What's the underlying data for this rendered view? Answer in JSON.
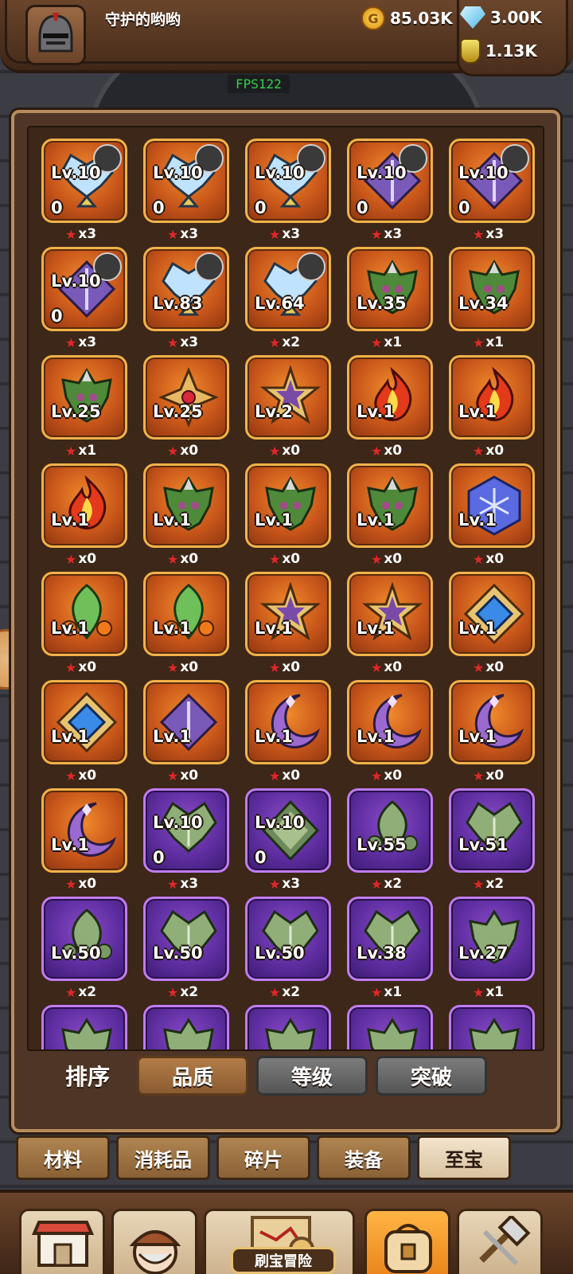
{
  "header": {
    "username": "守护的哟哟",
    "gold": "85.03K",
    "gems": "3.00K",
    "potion": "1.13K",
    "fps": "FPS122"
  },
  "items": [
    {
      "lv": "Lv.10",
      "sub": "0",
      "stars": "x3",
      "frame": "orange",
      "art": "wings",
      "hero": true
    },
    {
      "lv": "Lv.10",
      "sub": "0",
      "stars": "x3",
      "frame": "orange",
      "art": "wings",
      "hero": true
    },
    {
      "lv": "Lv.10",
      "sub": "0",
      "stars": "x3",
      "frame": "orange",
      "art": "wings",
      "hero": true
    },
    {
      "lv": "Lv.10",
      "sub": "0",
      "stars": "x3",
      "frame": "orange",
      "art": "diamond",
      "hero": true
    },
    {
      "lv": "Lv.10",
      "sub": "0",
      "stars": "x3",
      "frame": "orange",
      "art": "diamond",
      "hero": true
    },
    {
      "lv": "Lv.10",
      "sub": "0",
      "stars": "x3",
      "frame": "orange",
      "art": "diamond",
      "hero": true
    },
    {
      "lv": "Lv.83",
      "sub": "",
      "stars": "x3",
      "frame": "orange",
      "art": "wings",
      "hero": true
    },
    {
      "lv": "Lv.64",
      "sub": "",
      "stars": "x2",
      "frame": "orange",
      "art": "wings",
      "hero": true
    },
    {
      "lv": "Lv.35",
      "sub": "",
      "stars": "x1",
      "frame": "orange",
      "art": "demon",
      "hero": false
    },
    {
      "lv": "Lv.34",
      "sub": "",
      "stars": "x1",
      "frame": "orange",
      "art": "demon",
      "hero": false
    },
    {
      "lv": "Lv.25",
      "sub": "",
      "stars": "x1",
      "frame": "orange",
      "art": "demon",
      "hero": false
    },
    {
      "lv": "Lv.25",
      "sub": "",
      "stars": "x0",
      "frame": "orange",
      "art": "cross",
      "hero": false
    },
    {
      "lv": "Lv.2",
      "sub": "",
      "stars": "x0",
      "frame": "orange",
      "art": "star",
      "hero": false
    },
    {
      "lv": "Lv.1",
      "sub": "",
      "stars": "x0",
      "frame": "orange",
      "art": "flame",
      "hero": false
    },
    {
      "lv": "Lv.1",
      "sub": "",
      "stars": "x0",
      "frame": "orange",
      "art": "flame",
      "hero": false
    },
    {
      "lv": "Lv.1",
      "sub": "",
      "stars": "x0",
      "frame": "orange",
      "art": "flame",
      "hero": false
    },
    {
      "lv": "Lv.1",
      "sub": "",
      "stars": "x0",
      "frame": "orange",
      "art": "demon",
      "hero": false
    },
    {
      "lv": "Lv.1",
      "sub": "",
      "stars": "x0",
      "frame": "orange",
      "art": "demon",
      "hero": false
    },
    {
      "lv": "Lv.1",
      "sub": "",
      "stars": "x0",
      "frame": "orange",
      "art": "demon",
      "hero": false
    },
    {
      "lv": "Lv.1",
      "sub": "",
      "stars": "x0",
      "frame": "orange",
      "art": "hexagon",
      "hero": false
    },
    {
      "lv": "Lv.1",
      "sub": "",
      "stars": "x0",
      "frame": "orange",
      "art": "leaf",
      "hero": false
    },
    {
      "lv": "Lv.1",
      "sub": "",
      "stars": "x0",
      "frame": "orange",
      "art": "leaf",
      "hero": false
    },
    {
      "lv": "Lv.1",
      "sub": "",
      "stars": "x0",
      "frame": "orange",
      "art": "star",
      "hero": false
    },
    {
      "lv": "Lv.1",
      "sub": "",
      "stars": "x0",
      "frame": "orange",
      "art": "star",
      "hero": false
    },
    {
      "lv": "Lv.1",
      "sub": "",
      "stars": "x0",
      "frame": "orange",
      "art": "bluegem",
      "hero": false
    },
    {
      "lv": "Lv.1",
      "sub": "",
      "stars": "x0",
      "frame": "orange",
      "art": "bluegem",
      "hero": false
    },
    {
      "lv": "Lv.1",
      "sub": "",
      "stars": "x0",
      "frame": "orange",
      "art": "diamond",
      "hero": false
    },
    {
      "lv": "Lv.1",
      "sub": "",
      "stars": "x0",
      "frame": "orange",
      "art": "moon",
      "hero": false
    },
    {
      "lv": "Lv.1",
      "sub": "",
      "stars": "x0",
      "frame": "orange",
      "art": "moon",
      "hero": false
    },
    {
      "lv": "Lv.1",
      "sub": "",
      "stars": "x0",
      "frame": "orange",
      "art": "moon",
      "hero": false
    },
    {
      "lv": "Lv.1",
      "sub": "",
      "stars": "x0",
      "frame": "orange",
      "art": "moon",
      "hero": false
    },
    {
      "lv": "Lv.10",
      "sub": "0",
      "stars": "x3",
      "frame": "purple",
      "art": "greenwing",
      "hero": false
    },
    {
      "lv": "Lv.10",
      "sub": "0",
      "stars": "x3",
      "frame": "purple",
      "art": "greendiamond",
      "hero": false
    },
    {
      "lv": "Lv.55",
      "sub": "",
      "stars": "x2",
      "frame": "purple",
      "art": "greenleaf",
      "hero": false
    },
    {
      "lv": "Lv.51",
      "sub": "",
      "stars": "x2",
      "frame": "purple",
      "art": "greenwing",
      "hero": false
    },
    {
      "lv": "Lv.50",
      "sub": "",
      "stars": "x2",
      "frame": "purple",
      "art": "greenleaf",
      "hero": false
    },
    {
      "lv": "Lv.50",
      "sub": "",
      "stars": "x2",
      "frame": "purple",
      "art": "greenwing",
      "hero": false
    },
    {
      "lv": "Lv.50",
      "sub": "",
      "stars": "x2",
      "frame": "purple",
      "art": "greenwing",
      "hero": false
    },
    {
      "lv": "Lv.38",
      "sub": "",
      "stars": "x1",
      "frame": "purple",
      "art": "greenwing",
      "hero": false
    },
    {
      "lv": "Lv.27",
      "sub": "",
      "stars": "x1",
      "frame": "purple",
      "art": "greendemon",
      "hero": false
    },
    {
      "lv": "",
      "sub": "",
      "stars": "",
      "frame": "purple",
      "art": "greendemon",
      "hero": false
    },
    {
      "lv": "",
      "sub": "",
      "stars": "",
      "frame": "purple",
      "art": "greendemon",
      "hero": false
    },
    {
      "lv": "",
      "sub": "",
      "stars": "",
      "frame": "purple",
      "art": "greendemon",
      "hero": false
    },
    {
      "lv": "",
      "sub": "",
      "stars": "",
      "frame": "purple",
      "art": "greendemon",
      "hero": false
    },
    {
      "lv": "",
      "sub": "",
      "stars": "",
      "frame": "purple",
      "art": "greendemon",
      "hero": false
    }
  ],
  "sort": {
    "label": "排序",
    "options": [
      "品质",
      "等级",
      "突破"
    ],
    "active": 0
  },
  "categories": {
    "tabs": [
      "材料",
      "消耗品",
      "碎片",
      "装备",
      "至宝"
    ],
    "active": 4
  },
  "bottom_nav": {
    "items": [
      "shop-icon",
      "hero-icon",
      "adventure-map-icon",
      "backpack-icon",
      "forge-icon"
    ],
    "active": 3,
    "adventure_label": "刷宝冒险"
  },
  "colors": {
    "orange_frame": "#f2b24a",
    "purple_frame": "#c07cf2",
    "star": "#e02828",
    "fps": "#35d04a"
  }
}
